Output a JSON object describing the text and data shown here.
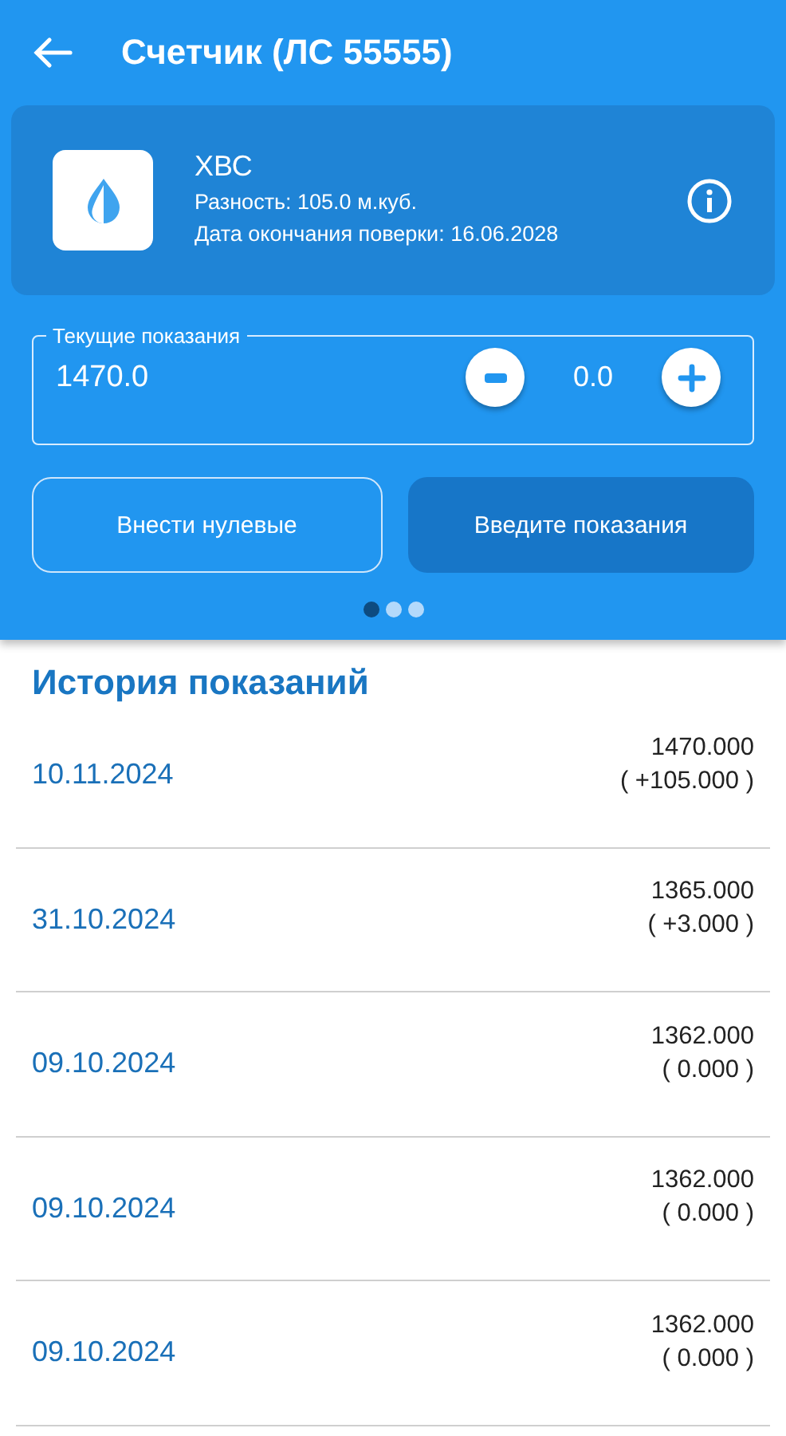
{
  "header": {
    "title": "Счетчик (ЛС 55555)"
  },
  "meter": {
    "name": "ХВС",
    "difference": "Разность: 105.0 м.куб.",
    "verification": "Дата окончания поверки: 16.06.2028"
  },
  "reading_field": {
    "label": "Текущие показания",
    "value": "1470.0",
    "delta": "0.0"
  },
  "buttons": [
    {
      "label": "Внести нулевые",
      "kind": "outline"
    },
    {
      "label": "Введите показания",
      "kind": "filled"
    }
  ],
  "pager": [
    {
      "selected": true
    },
    {
      "selected": false
    },
    {
      "selected": false
    }
  ],
  "history": {
    "title": "История показаний",
    "rows": [
      {
        "date": "10.11.2024",
        "value": "1470.000",
        "change": "( +105.000 )"
      },
      {
        "date": "31.10.2024",
        "value": "1365.000",
        "change": "( +3.000 )"
      },
      {
        "date": "09.10.2024",
        "value": "1362.000",
        "change": "( 0.000 )"
      },
      {
        "date": "09.10.2024",
        "value": "1362.000",
        "change": "( 0.000 )"
      },
      {
        "date": "09.10.2024",
        "value": "1362.000",
        "change": "( 0.000 )"
      }
    ]
  }
}
